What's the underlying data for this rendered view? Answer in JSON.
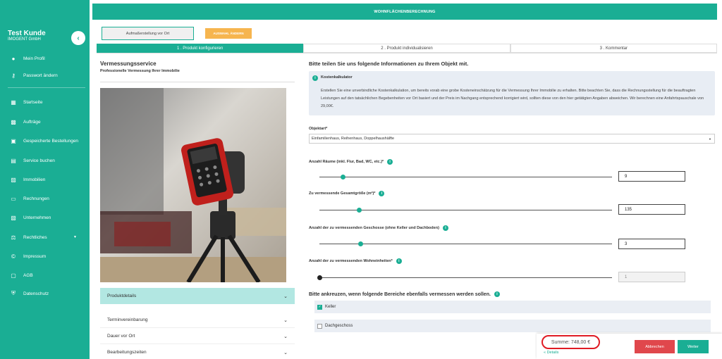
{
  "sidebar": {
    "user_name": "Test Kunde",
    "company": "IMOGENT GmbH",
    "collapse_icon": "‹",
    "items": [
      {
        "label": "Mein Profil",
        "icon": "user-icon"
      },
      {
        "label": "Passwort ändern",
        "icon": "key-icon"
      },
      {
        "label": "Startseite",
        "icon": "dashboard-icon"
      },
      {
        "label": "Aufträge",
        "icon": "briefcase-icon"
      },
      {
        "label": "Gespeicherte Bestellungen",
        "icon": "save-icon"
      },
      {
        "label": "Service buchen",
        "icon": "document-icon"
      },
      {
        "label": "Immobilien",
        "icon": "building-icon"
      },
      {
        "label": "Rechnungen",
        "icon": "credit-card-icon"
      },
      {
        "label": "Unternehmen",
        "icon": "company-icon"
      },
      {
        "label": "Rechtliches",
        "icon": "scale-icon"
      },
      {
        "label": "Impressum",
        "icon": "copyright-icon"
      },
      {
        "label": "AGB",
        "icon": "file-icon"
      },
      {
        "label": "Datenschutz",
        "icon": "shield-icon"
      }
    ]
  },
  "header": {
    "title": "WOHNFLÄCHENBERECHNUNG",
    "aufmass_button": "Aufmaßerstellung vor Ort",
    "auswahl_button": "AUSWAHL ÄNDERN"
  },
  "steps": [
    {
      "label": "1 . Produkt konfigurieren",
      "active": true
    },
    {
      "label": "2 . Produkt individualisieren",
      "active": false
    },
    {
      "label": "3 . Kommentar",
      "active": false
    }
  ],
  "left": {
    "title": "Vermessungsservice",
    "subtitle": "Professionelle Vermessung Ihrer Immobilie",
    "accordion": [
      {
        "label": "Produktdetails"
      },
      {
        "label": "Terminvereinbarung"
      },
      {
        "label": "Dauer vor Ort"
      },
      {
        "label": "Bearbeitungszeiten"
      }
    ]
  },
  "form": {
    "heading": "Bitte teilen Sie uns folgende Informationen zu Ihrem Objekt mit.",
    "info_title": "Kostenkalkulator",
    "info_text": "Erstellen Sie eine unverbindliche Kostenkalkulation, um bereits vorab eine grobe Kosteneinschätzung für die Vermessung Ihrer Immobilie zu erhalten. Bitte beachten Sie, dass die Rechnungsstellung für die beauftragten Leistungen auf den tatsächlichen Begebenheiten vor Ort basiert und der Preis im Nachgang entsprechend korrigiert wird, sollten diese von den hier getätigten Angaben abweichen. Wir berechnen eine Anfahrtspauschale von 29,00€.",
    "objektart_label": "Objektart*",
    "objektart_value": "Einfamilienhaus, Reihenhaus, Doppelhaushälfte",
    "sliders": [
      {
        "label": "Anzahl Räume (inkl. Flur, Bad, WC, etc.)*",
        "value": "9",
        "fraction": 0.08
      },
      {
        "label": "Zu vermessende Gesamtgröße (m²)*",
        "value": "135",
        "fraction": 0.135
      },
      {
        "label": "Anzahl der zu vermessenden Geschosse (ohne Keller und Dachboden)",
        "value": "3",
        "fraction": 0.14
      },
      {
        "label": "Anzahl der zu vermessenden Wohneinheiten*",
        "value": "1",
        "fraction": 0.0
      }
    ],
    "checkbox_heading": "Bitte ankreuzen, wenn folgende Bereiche ebenfalls vermessen werden sollen.",
    "checkboxes": [
      {
        "label": "Keller",
        "checked": true
      },
      {
        "label": "Dachgeschoss",
        "checked": false
      }
    ]
  },
  "footer": {
    "sum": "Summe: 748,00 €",
    "details": "« Details",
    "cancel": "Abbrechen",
    "next": "Weiter"
  },
  "colors": {
    "accent": "#1aae94",
    "warning": "#f6b54f",
    "danger": "#e0474c"
  }
}
